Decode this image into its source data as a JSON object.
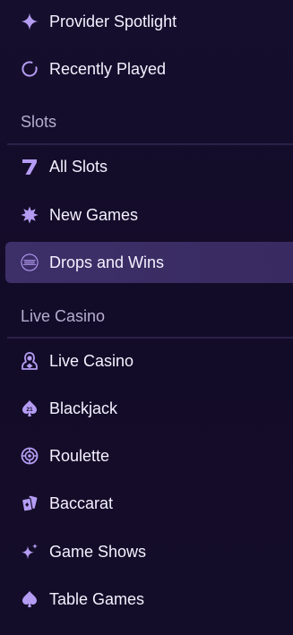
{
  "nav": {
    "top_items": [
      {
        "label": "Provider Spotlight",
        "icon": "sparkle-icon"
      },
      {
        "label": "Recently Played",
        "icon": "loading-arc-icon"
      }
    ],
    "sections": [
      {
        "header": "Slots",
        "items": [
          {
            "label": "All Slots",
            "icon": "seven-icon"
          },
          {
            "label": "New Games",
            "icon": "starburst-icon"
          },
          {
            "label": "Drops and Wins",
            "icon": "drops-and-wins-icon",
            "active": true
          }
        ]
      },
      {
        "header": "Live Casino",
        "items": [
          {
            "label": "Live Casino",
            "icon": "dealer-icon"
          },
          {
            "label": "Blackjack",
            "icon": "spade-21-icon"
          },
          {
            "label": "Roulette",
            "icon": "roulette-icon"
          },
          {
            "label": "Baccarat",
            "icon": "cards-icon"
          },
          {
            "label": "Game Shows",
            "icon": "sparkles-icon"
          },
          {
            "label": "Table Games",
            "icon": "spade-icon"
          }
        ]
      }
    ]
  },
  "colors": {
    "background": "#150f2b",
    "icon_accent": "#b49cf3",
    "active_background": "#3a2d63",
    "header_text": "#b6aed0",
    "divider": "#2a2148"
  }
}
